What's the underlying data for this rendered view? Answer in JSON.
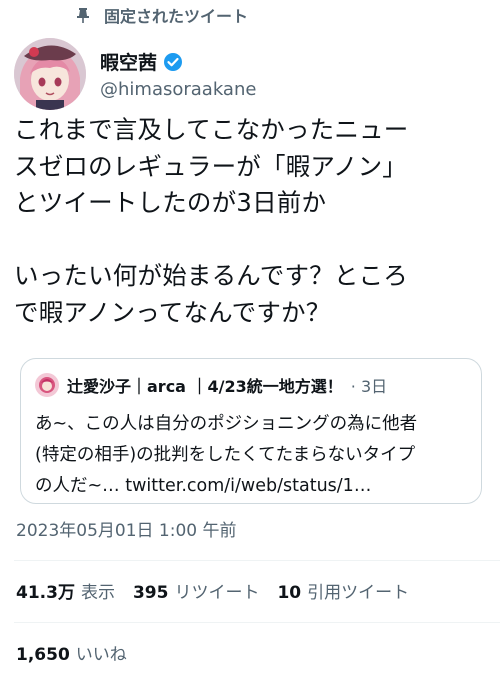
{
  "pinned": {
    "label": "固定されたツイート",
    "icon": "pin-icon"
  },
  "author": {
    "display_name": "暇空茜",
    "handle": "@himasoraakane",
    "verified_icon": "verified-badge-icon",
    "verified_color": "#1d9bf0"
  },
  "tweet": {
    "text": "これまで言及してこなかったニュー\nスゼロのレギュラーが「暇アノン」\nとツイートしたのが3日前か\n\nいったい何が始まるんです？ところ\nで暇アノンってなんですか？"
  },
  "quote": {
    "author": "辻愛沙子｜arca ｜4/23統一地方選！",
    "time": "· 3日",
    "text": "あ~、この人は自分のポジショニングの為に他者\n(特定の相手)の批判をしたくてたまらないタイプ\nの人だ~… twitter.com/i/web/status/1…"
  },
  "timestamp": "2023年05月01日 1:00 午前",
  "stats": {
    "views": {
      "count": "41.3万",
      "label": "表示"
    },
    "retweets": {
      "count": "395",
      "label": "リツイート"
    },
    "quotes": {
      "count": "10",
      "label": "引用ツイート"
    },
    "likes": {
      "count": "1,650",
      "label": "いいね"
    }
  },
  "colors": {
    "text": "#0f1419",
    "secondary": "#536471",
    "border": "#cfd9de",
    "accent": "#1d9bf0"
  }
}
